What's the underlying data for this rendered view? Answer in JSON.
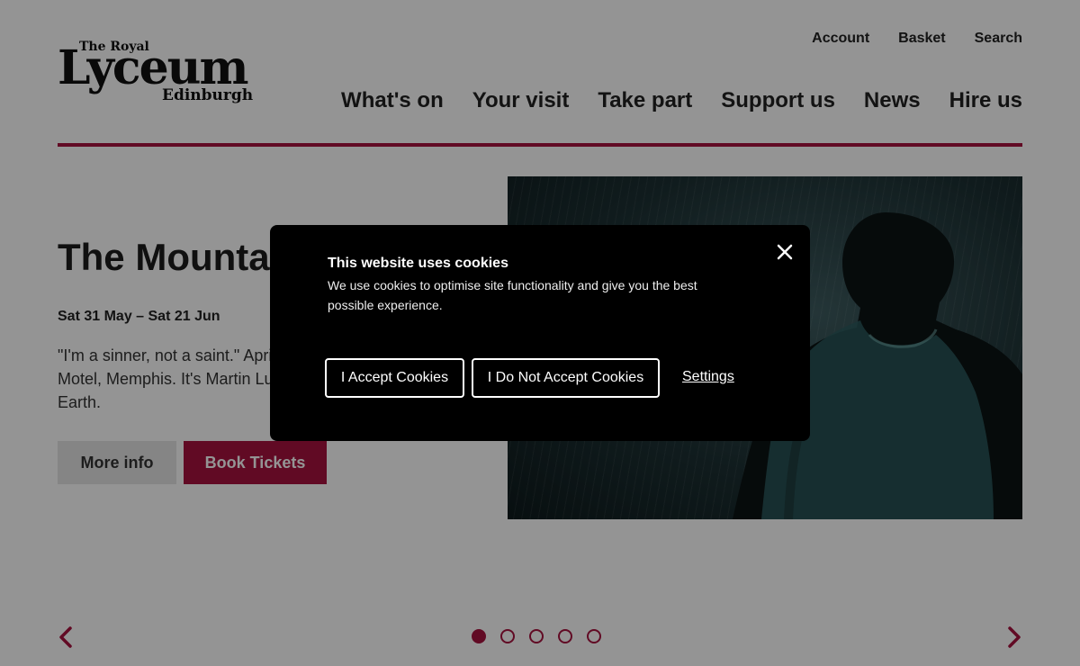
{
  "brand": {
    "logo_top": "The Royal",
    "logo_main": "Lyceum",
    "logo_bottom": "Edinburgh",
    "accent_color": "#a8123e"
  },
  "utility_nav": [
    "Account",
    "Basket",
    "Search"
  ],
  "main_nav": [
    "What's on",
    "Your visit",
    "Take part",
    "Support us",
    "News",
    "Hire us"
  ],
  "hero": {
    "title": "The Mountaintop",
    "dates": "Sat 31 May – Sat 21 Jun",
    "description": "\"I'm a sinner, not a saint.\" April 3, 1968. Room 306, Lorraine Motel, Memphis. It's Martin Luther King Jr.'s last night on Earth.",
    "more_info_label": "More info",
    "book_label": "Book Tickets",
    "image_icon": "man-in-rain-photo"
  },
  "carousel": {
    "prev_icon": "chevron-left-icon",
    "next_icon": "chevron-right-icon",
    "slide_count": 5,
    "active_slide": 1
  },
  "cookie_banner": {
    "title": "This website uses cookies",
    "text": "We use cookies to optimise site functionality and give you the best possible experience.",
    "accept_label": "I Accept Cookies",
    "decline_label": "I Do Not Accept Cookies",
    "settings_label": "Settings",
    "close_icon": "close-icon"
  }
}
